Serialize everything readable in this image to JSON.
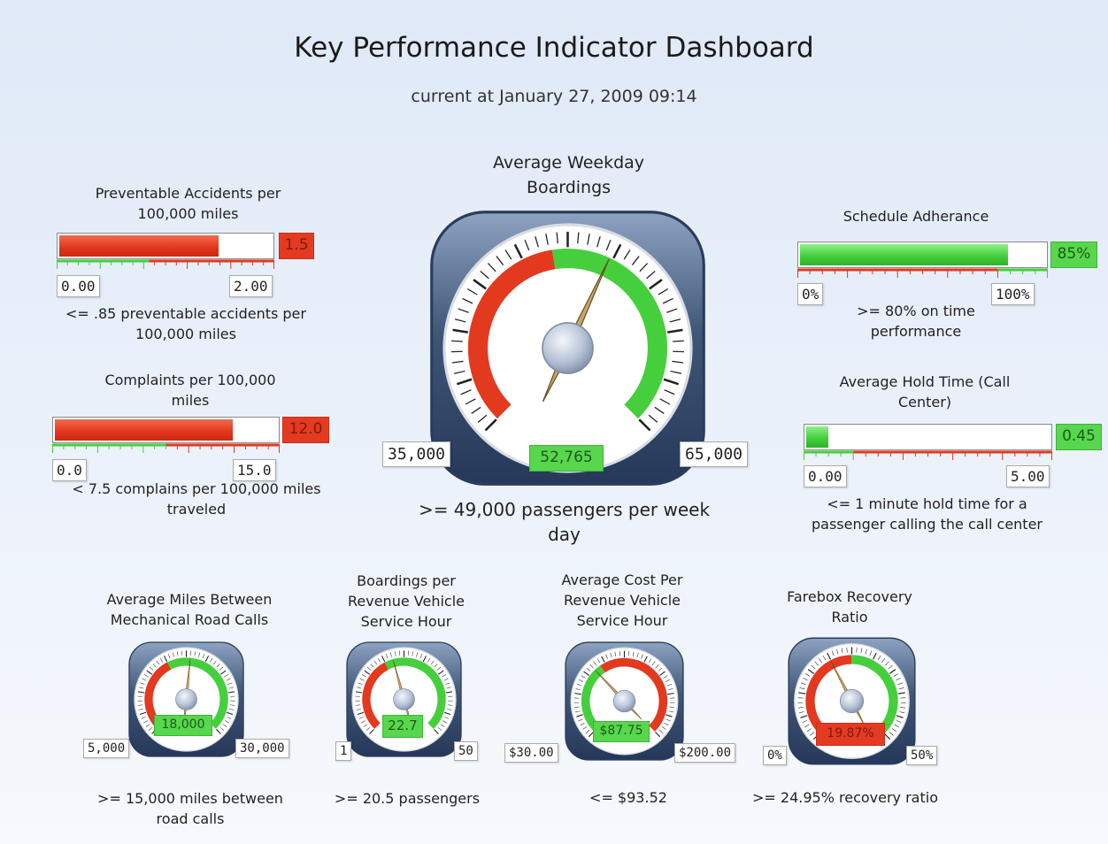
{
  "header": {
    "title": "Key Performance Indicator Dashboard",
    "subtitle": "current at January 27, 2009 09:14"
  },
  "colors": {
    "red": "#e2391f",
    "green": "#45cf3c",
    "gauge_frame": "#3f5677"
  },
  "bars": {
    "accidents": {
      "title": "Preventable Accidents per 100,000 miles",
      "value": 1.5,
      "value_label": "1.5",
      "min": "0.00",
      "max": "2.00",
      "min_value": 0,
      "max_value": 2,
      "target_value": 0.85,
      "status": "red",
      "goal": "<= .85 preventable accidents per 100,000 miles"
    },
    "complaints": {
      "title": "Complaints per 100,000 miles",
      "value": 12.0,
      "value_label": "12.0",
      "min": "0.0",
      "max": "15.0",
      "min_value": 0,
      "max_value": 15,
      "target_value": 7.5,
      "status": "red",
      "goal": "< 7.5 complains per 100,000 miles traveled"
    },
    "schedule": {
      "title": "Schedule Adherance",
      "value": 85,
      "value_label": "85%",
      "min": "0%",
      "max": "100%",
      "min_value": 0,
      "max_value": 100,
      "target_value": 80,
      "status": "green",
      "goal": ">= 80% on time performance"
    },
    "hold_time": {
      "title": "Average Hold Time (Call Center)",
      "value": 0.45,
      "value_label": "0.45",
      "min": "0.00",
      "max": "5.00",
      "min_value": 0,
      "max_value": 5,
      "target_value": 1,
      "status": "green",
      "goal": "<= 1 minute hold time for a passenger calling the call center"
    }
  },
  "gauges": {
    "boardings": {
      "title": "Average Weekday Boardings",
      "value": 52765,
      "value_label": "52,765",
      "min": "35,000",
      "max": "65,000",
      "min_value": 35000,
      "max_value": 65000,
      "target_value": 49000,
      "status": "green",
      "good_side": "high",
      "goal": ">= 49,000 passengers per week day"
    },
    "miles": {
      "title": "Average Miles Between Mechanical Road Calls",
      "value": 18000,
      "value_label": "18,000",
      "min": "5,000",
      "max": "30,000",
      "min_value": 5000,
      "max_value": 30000,
      "target_value": 15000,
      "status": "green",
      "good_side": "high",
      "goal": ">= 15,000 miles between road calls"
    },
    "boardings_hour": {
      "title": "Boardings per Revenue Vehicle Service Hour",
      "value": 22.7,
      "value_label": "22.7",
      "min": "1",
      "max": "50",
      "min_value": 1,
      "max_value": 50,
      "target_value": 20.5,
      "status": "green",
      "good_side": "high",
      "goal": ">= 20.5 passengers"
    },
    "cost": {
      "title": "Average Cost Per Revenue Vehicle Service Hour",
      "value": 87.75,
      "value_label": "$87.75",
      "min": "$30.00",
      "max": "$200.00",
      "min_value": 30,
      "max_value": 200,
      "target_value": 93.52,
      "status": "green",
      "good_side": "low",
      "goal": "<= $93.52"
    },
    "farebox": {
      "title": "Farebox Recovery Ratio",
      "value": 19.87,
      "value_label": "19.87%",
      "min": "0%",
      "max": "50%",
      "min_value": 0,
      "max_value": 50,
      "target_value": 24.95,
      "status": "red",
      "good_side": "high",
      "goal": ">= 24.95% recovery ratio"
    }
  }
}
